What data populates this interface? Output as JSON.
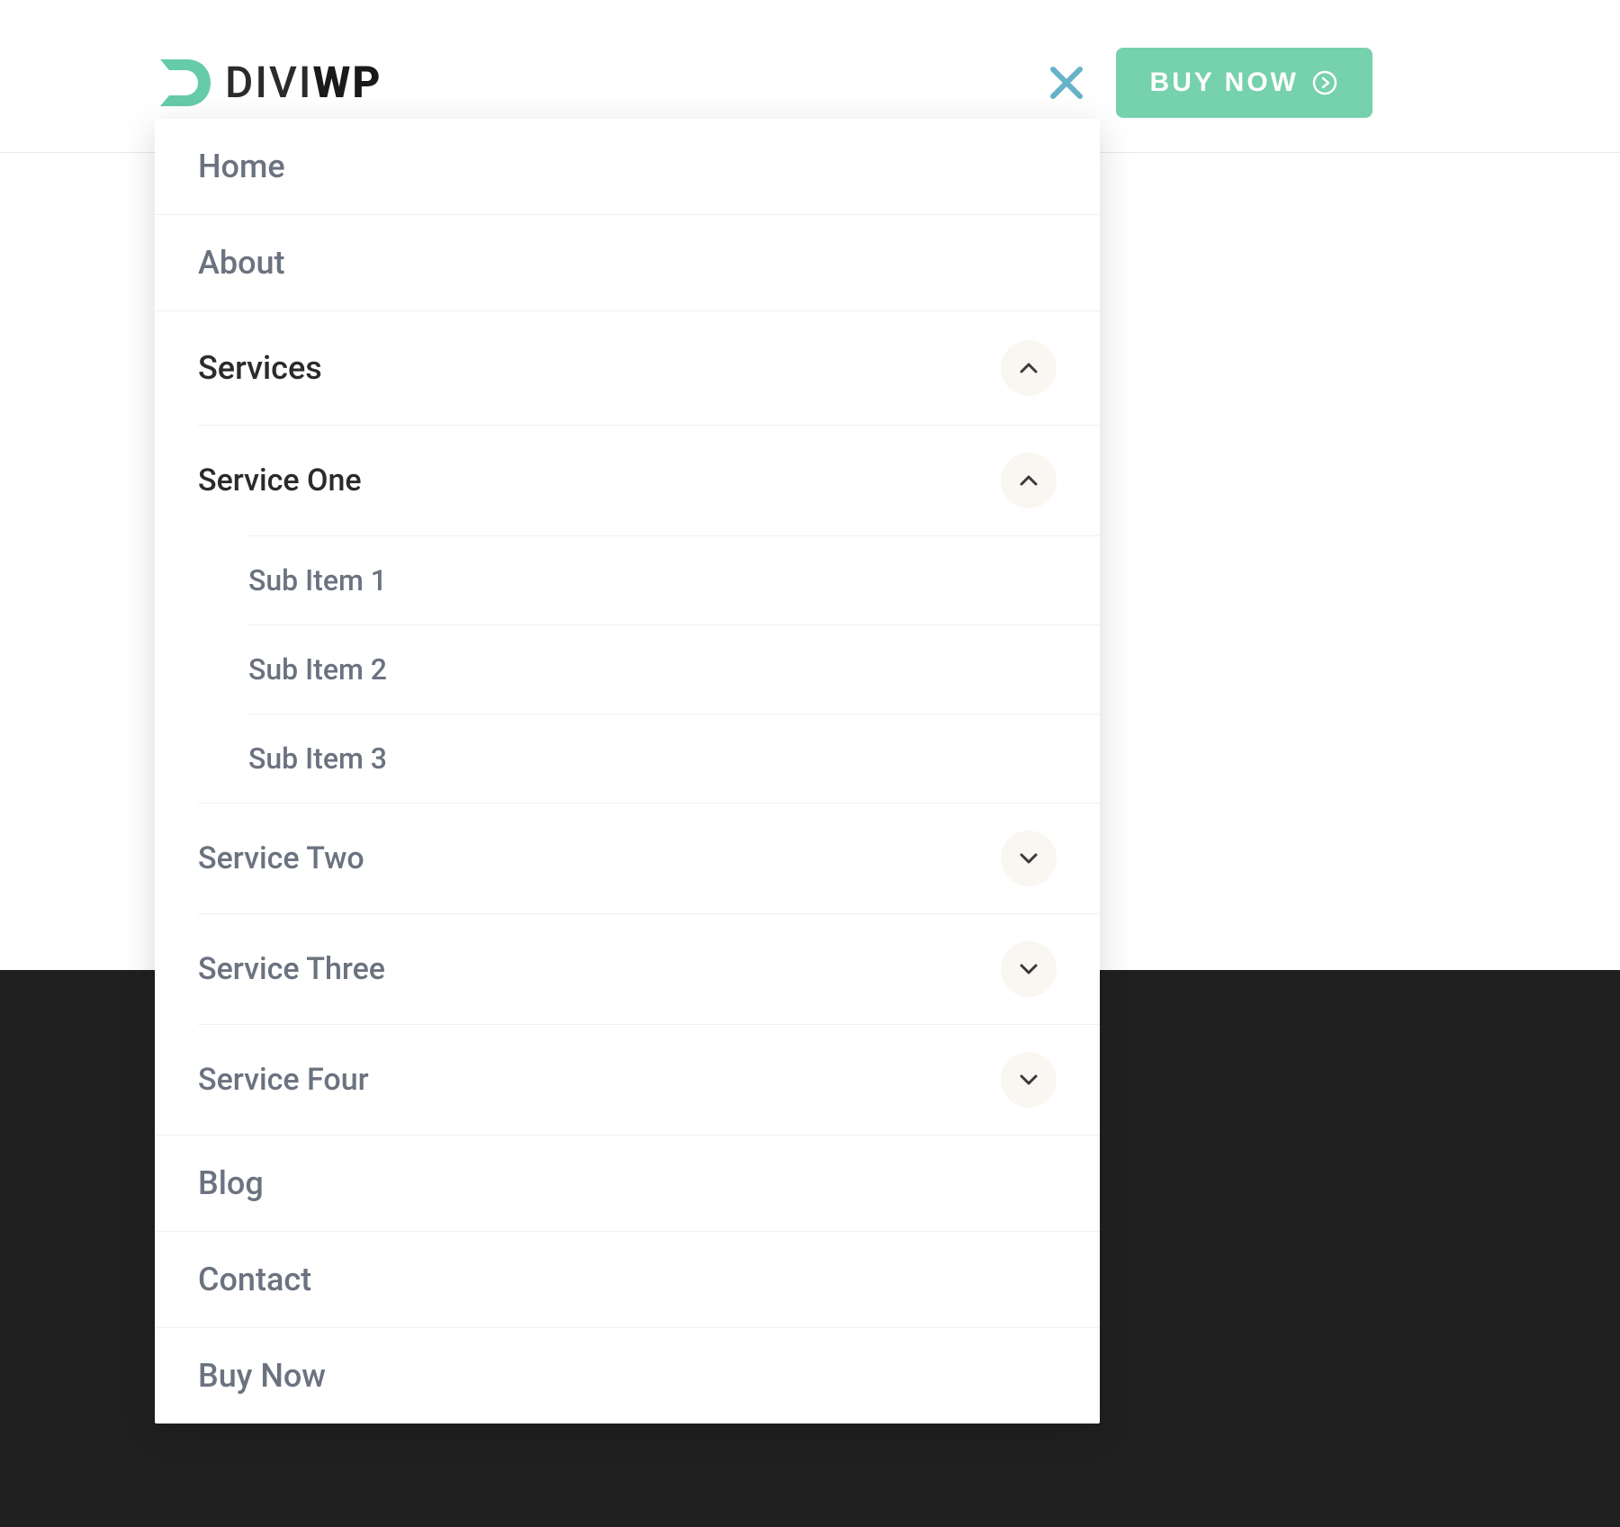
{
  "header": {
    "logo_text_regular": "DIVI",
    "logo_text_bold": "WP",
    "buy_button_label": "BUY NOW"
  },
  "menu": {
    "items": [
      {
        "label": "Home"
      },
      {
        "label": "About"
      },
      {
        "label": "Services",
        "expanded": true,
        "children": [
          {
            "label": "Service One",
            "expanded": true,
            "children": [
              {
                "label": "Sub Item 1"
              },
              {
                "label": "Sub Item 2"
              },
              {
                "label": "Sub Item 3"
              }
            ]
          },
          {
            "label": "Service Two",
            "expanded": false
          },
          {
            "label": "Service Three",
            "expanded": false
          },
          {
            "label": "Service Four",
            "expanded": false
          }
        ]
      },
      {
        "label": "Blog"
      },
      {
        "label": "Contact"
      },
      {
        "label": "Buy Now"
      }
    ]
  },
  "colors": {
    "accent": "#76d1ad",
    "close_icon": "#66b2c7",
    "text_active": "#2b2b2b",
    "text_muted": "#6b7280",
    "toggle_bg": "#faf6f2",
    "dark_bg": "#202020"
  }
}
